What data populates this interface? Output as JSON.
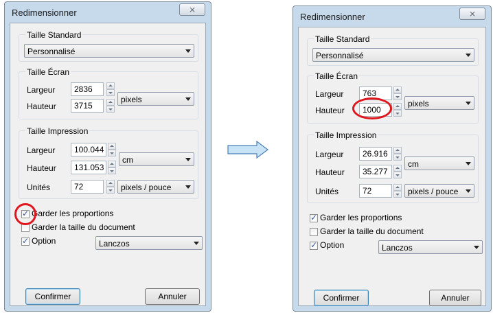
{
  "colors": {
    "highlight": "#e0161d",
    "arrow_fill": "#c8e3f6",
    "arrow_stroke": "#4a7fb6"
  },
  "dialogs": [
    {
      "title": "Redimensionner",
      "close_icon": "⨯",
      "standard": {
        "label": "Taille Standard",
        "value": "Personnalisé"
      },
      "screen": {
        "label": "Taille Écran",
        "width_label": "Largeur",
        "width": "2836",
        "height_label": "Hauteur",
        "height": "3715",
        "unit": "pixels"
      },
      "print": {
        "label": "Taille Impression",
        "width_label": "Largeur",
        "width": "100.044",
        "height_label": "Hauteur",
        "height": "131.053",
        "unit": "cm",
        "units_label": "Unités",
        "units_value": "72",
        "units_unit": "pixels / pouce"
      },
      "keep_proportions": "Garder les proportions",
      "keep_doc_size": "Garder la taille du document",
      "option": {
        "label": "Option",
        "value": "Lanczos"
      },
      "confirm": "Confirmer",
      "cancel": "Annuler"
    },
    {
      "title": "Redimensionner",
      "close_icon": "⨯",
      "standard": {
        "label": "Taille Standard",
        "value": "Personnalisé"
      },
      "screen": {
        "label": "Taille Écran",
        "width_label": "Largeur",
        "width": "763",
        "height_label": "Hauteur",
        "height": "1000",
        "unit": "pixels"
      },
      "print": {
        "label": "Taille Impression",
        "width_label": "Largeur",
        "width": "26.916",
        "height_label": "Hauteur",
        "height": "35.277",
        "unit": "cm",
        "units_label": "Unités",
        "units_value": "72",
        "units_unit": "pixels / pouce"
      },
      "keep_proportions": "Garder les proportions",
      "keep_doc_size": "Garder la taille du document",
      "option": {
        "label": "Option",
        "value": "Lanczos"
      },
      "confirm": "Confirmer",
      "cancel": "Annuler"
    }
  ]
}
